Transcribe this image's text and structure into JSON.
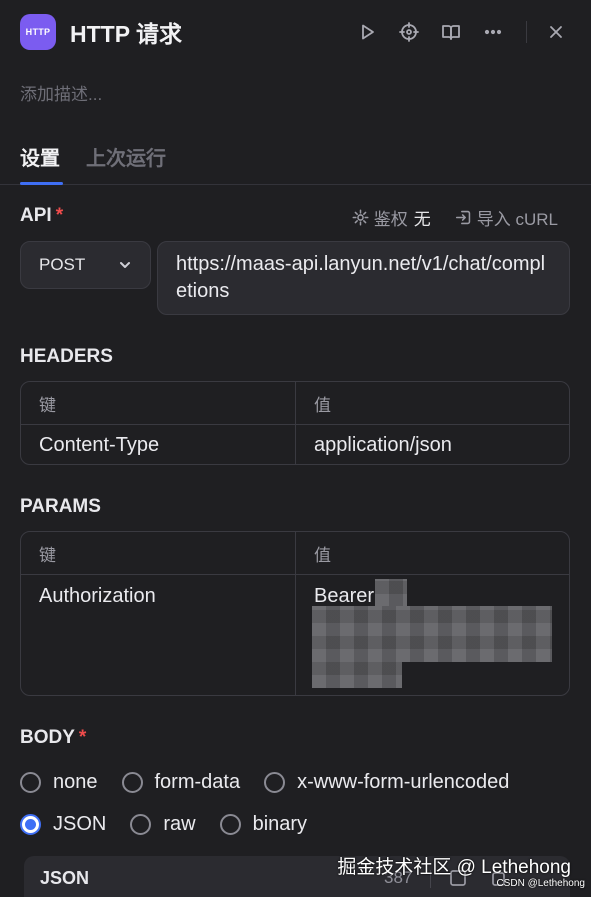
{
  "header": {
    "icon_text": "HTTP",
    "title": "HTTP 请求",
    "actions": [
      "play-icon",
      "locate-icon",
      "book-icon",
      "more-icon",
      "close-icon"
    ]
  },
  "description_placeholder": "添加描述...",
  "tabs": [
    {
      "label": "设置",
      "active": true
    },
    {
      "label": "上次运行",
      "active": false
    }
  ],
  "api": {
    "label": "API",
    "required_mark": "*",
    "auth_label": "鉴权",
    "auth_value": "无",
    "import_label": "导入 cURL",
    "method": "POST",
    "url": "https://maas-api.lanyun.net/v1/chat/completions"
  },
  "headers": {
    "label": "HEADERS",
    "col_key": "键",
    "col_value": "值",
    "rows": [
      {
        "key": "Content-Type",
        "value": "application/json"
      }
    ]
  },
  "params": {
    "label": "PARAMS",
    "col_key": "键",
    "col_value": "值",
    "rows": [
      {
        "key": "Authorization",
        "value": "Bearer"
      }
    ]
  },
  "body": {
    "label": "BODY",
    "required_mark": "*",
    "options": [
      "none",
      "form-data",
      "x-www-form-urlencoded",
      "JSON",
      "raw",
      "binary"
    ],
    "selected": "JSON",
    "editor_label": "JSON",
    "char_count": "387"
  },
  "watermark": {
    "main": "掘金技术社区 @ Lethehong",
    "small": "CSDN @Lethehong"
  },
  "colors": {
    "background": "#1f1f22",
    "accent": "#3f6ff5",
    "icon_bg": "#7b5cf0",
    "required": "#f04c4c"
  }
}
